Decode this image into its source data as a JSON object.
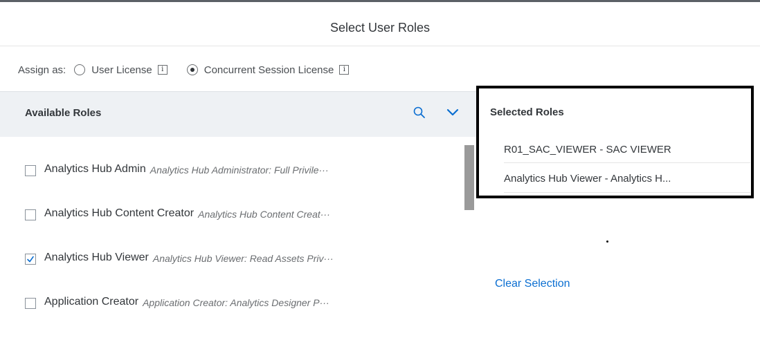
{
  "dialog": {
    "title": "Select User Roles"
  },
  "assign": {
    "label": "Assign as:",
    "options": [
      {
        "label": "User License",
        "selected": false
      },
      {
        "label": "Concurrent Session License",
        "selected": true
      }
    ],
    "info_glyph": "i"
  },
  "available": {
    "title": "Available Roles",
    "roles": [
      {
        "name": "Analytics Hub Admin",
        "description": "Analytics Hub Administrator: Full Privile···",
        "checked": false
      },
      {
        "name": "Analytics Hub Content Creator",
        "description": "Analytics Hub Content Creat···",
        "checked": false
      },
      {
        "name": "Analytics Hub Viewer",
        "description": "Analytics Hub Viewer: Read Assets Priv···",
        "checked": true
      },
      {
        "name": "Application Creator",
        "description": "Application Creator: Analytics Designer P···",
        "checked": false
      }
    ]
  },
  "selected": {
    "title": "Selected Roles",
    "items": [
      "R01_SAC_VIEWER - SAC VIEWER",
      "Analytics Hub Viewer - Analytics H..."
    ],
    "clear_label": "Clear Selection"
  },
  "colors": {
    "link": "#0a6ed1",
    "header_bg": "#eef1f4",
    "highlight_border": "#000000"
  }
}
